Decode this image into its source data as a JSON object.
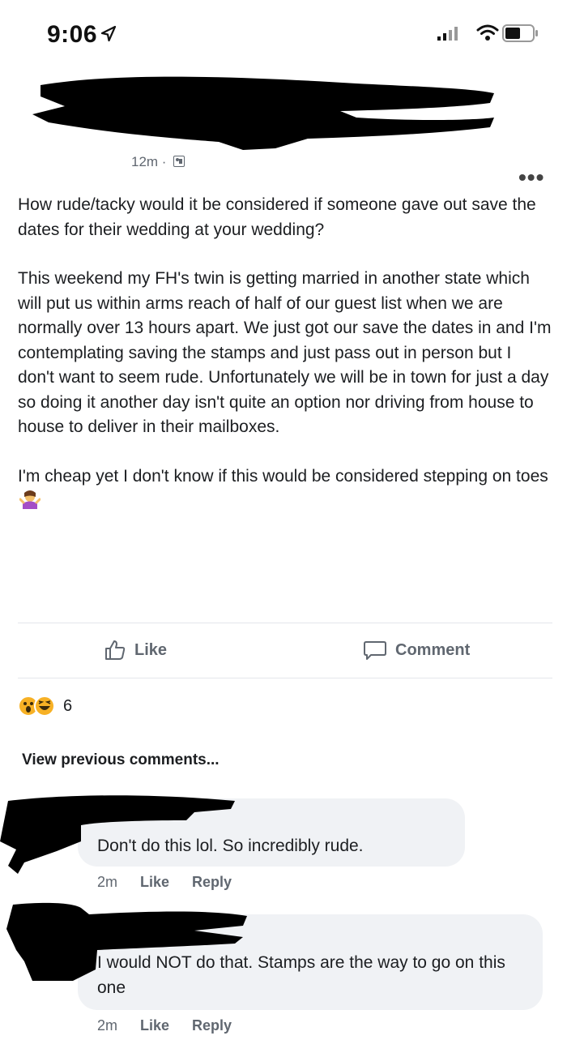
{
  "status_bar": {
    "time": "9:06"
  },
  "post": {
    "time": "12m ·",
    "paragraphs": [
      "How rude/tacky would it be considered if someone gave out save the dates for their wedding at your wedding?",
      "This weekend my FH's twin is getting married in another state which will put us within arms reach of half of our guest list when we are normally over 13 hours apart. We just got our save the dates in and I'm contemplating saving the stamps and just pass out in person but I don't want to seem rude. Unfortunately we will be in town for just a day so doing it another day isn't quite an option nor driving from house to house to deliver in their mailboxes.",
      "I'm cheap yet I don't know if this would be considered stepping on toes"
    ],
    "emoji_name": "woman-shrugging-emoji"
  },
  "actions": {
    "like_label": "Like",
    "comment_label": "Comment"
  },
  "reactions": {
    "icons": [
      "wow-reaction",
      "haha-reaction"
    ],
    "count": "6"
  },
  "view_previous": "View previous comments...",
  "comments": [
    {
      "text": "Don't do this lol. So incredibly rude.",
      "time": "2m",
      "like": "Like",
      "reply": "Reply"
    },
    {
      "text": "I would NOT do that. Stamps are the way to go on this one",
      "time": "2m",
      "like": "Like",
      "reply": "Reply"
    }
  ],
  "colors": {
    "text": "#1c1e21",
    "secondary": "#606770",
    "bubble": "#f0f2f5",
    "reaction": "#f7b125"
  }
}
